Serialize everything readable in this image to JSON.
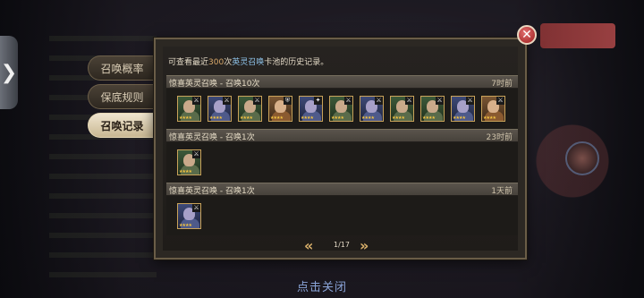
{
  "background": {
    "top_right_banner": "",
    "close_hint": "点击关闭"
  },
  "tabs": [
    {
      "label": "召唤概率",
      "active": false
    },
    {
      "label": "保底规则",
      "active": false
    },
    {
      "label": "召唤记录",
      "active": true
    }
  ],
  "panel": {
    "info": {
      "prefix": "可查看最近",
      "count": "300",
      "mid": "次",
      "pool": "英灵召唤",
      "suffix": "卡池的历史记录。"
    },
    "records": [
      {
        "title": "惊喜英灵召唤 - 召唤10次",
        "time": "7时前",
        "heroes": [
          {
            "icon": "hero-knight-icon",
            "rarity": "green",
            "class": "⚔"
          },
          {
            "icon": "hero-mage-icon",
            "rarity": "blue",
            "class": "⚔"
          },
          {
            "icon": "hero-warrior-icon",
            "rarity": "green",
            "class": "⚔"
          },
          {
            "icon": "hero-paladin-icon",
            "rarity": "orange",
            "class": "⛨"
          },
          {
            "icon": "hero-sorcerer-icon",
            "rarity": "blue",
            "class": "✦"
          },
          {
            "icon": "hero-berserker-icon",
            "rarity": "green",
            "class": "⚔"
          },
          {
            "icon": "hero-assassin-icon",
            "rarity": "blue",
            "class": "⚔"
          },
          {
            "icon": "hero-guard-icon",
            "rarity": "green",
            "class": "⚔"
          },
          {
            "icon": "hero-archer-icon",
            "rarity": "green",
            "class": "⚔"
          },
          {
            "icon": "hero-rogue-icon",
            "rarity": "blue",
            "class": "⚔"
          },
          {
            "icon": "hero-lord-icon",
            "rarity": "orange",
            "class": "⚔"
          }
        ]
      },
      {
        "title": "惊喜英灵召唤 - 召唤1次",
        "time": "23时前",
        "heroes": [
          {
            "icon": "hero-rogue-icon",
            "rarity": "green",
            "class": "⚔"
          }
        ]
      },
      {
        "title": "惊喜英灵召唤 - 召唤1次",
        "time": "1天前",
        "heroes": [
          {
            "icon": "hero-frost-icon",
            "rarity": "blue",
            "class": "⚔"
          }
        ]
      }
    ],
    "pager": {
      "page": "1/17",
      "prev_icon": "double-chevron-left-icon",
      "next_icon": "double-chevron-right-icon"
    }
  },
  "colors": {
    "accent_gold": "#d9b06a",
    "highlight_blue": "#8fc3ea",
    "close_red": "#b03434"
  }
}
